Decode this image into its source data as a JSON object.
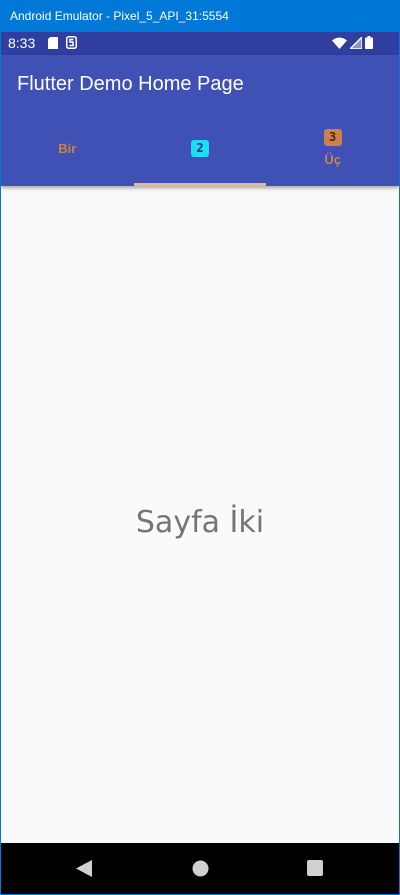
{
  "window": {
    "title": "Android Emulator - Pixel_5_API_31:5554"
  },
  "statusbar": {
    "time": "8:33",
    "left_icons": [
      "sd-card-icon",
      "notification-s-icon"
    ],
    "right_icons": [
      "wifi-icon",
      "signal-icon",
      "battery-icon"
    ]
  },
  "appbar": {
    "title": "Flutter Demo Home Page",
    "background": "#3f51b5",
    "status_color": "#303f9f"
  },
  "tabs": [
    {
      "label": "Bir",
      "icon": "",
      "selected": false
    },
    {
      "label": "",
      "icon": "2",
      "selected": true
    },
    {
      "label": "Üç",
      "icon": "3",
      "selected": false
    }
  ],
  "colors": {
    "tab_unselected": "#c9824a",
    "tab_selected_icon": "#18e0f0",
    "indicator": "#e8b88a"
  },
  "content": {
    "page_text": "Sayfa İki"
  },
  "navbar": {
    "buttons": [
      "back-icon",
      "home-icon",
      "recents-icon"
    ]
  }
}
